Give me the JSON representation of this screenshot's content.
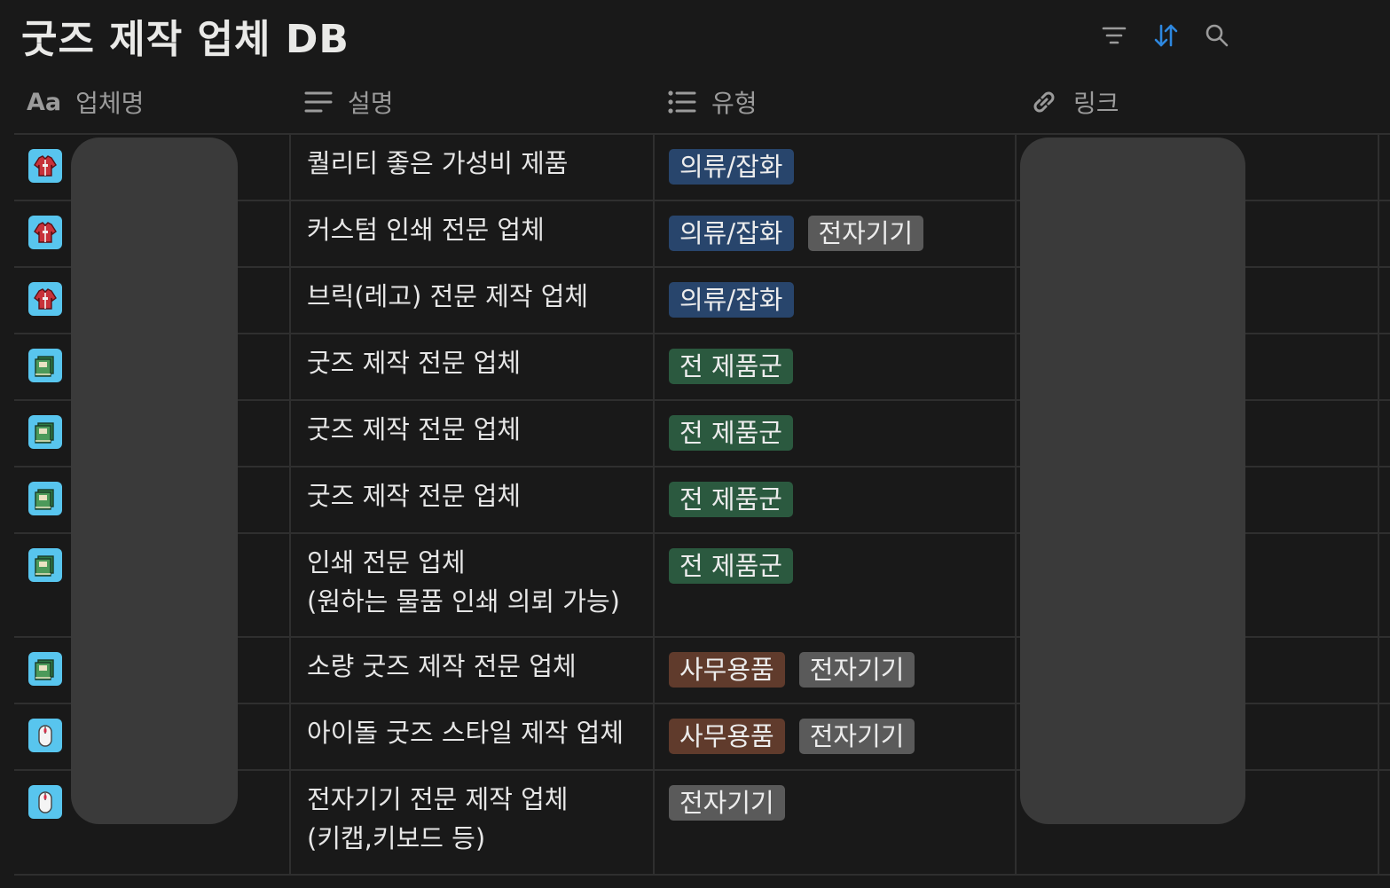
{
  "page": {
    "title": "굿즈 제작 업체 DB"
  },
  "toolbar": {
    "filter_icon": "filter-icon",
    "sort_icon": "sort-icon",
    "search_icon": "search-icon",
    "sort_active_color": "#2e88e0"
  },
  "columns": {
    "name": {
      "label": "업체명",
      "icon": "title-property-icon",
      "icon_text": "Aa"
    },
    "description": {
      "label": "설명",
      "icon": "text-property-icon"
    },
    "type": {
      "label": "유형",
      "icon": "multi-select-icon"
    },
    "link": {
      "label": "링크",
      "icon": "link-icon"
    }
  },
  "tag_colors": {
    "blue": "#28456c",
    "gray": "#5a5a5a",
    "green": "#2b593f",
    "brown": "#603b2c"
  },
  "rows": [
    {
      "icon": "jacket-icon",
      "description": "퀄리티 좋은 가성비 제품",
      "tags": [
        {
          "label": "의류/잡화",
          "color": "blue"
        }
      ]
    },
    {
      "icon": "jacket-icon",
      "description": "커스텀 인쇄 전문 업체",
      "tags": [
        {
          "label": "의류/잡화",
          "color": "blue"
        },
        {
          "label": "전자기기",
          "color": "gray"
        }
      ]
    },
    {
      "icon": "jacket-icon",
      "description": "브릭(레고) 전문 제작 업체",
      "tags": [
        {
          "label": "의류/잡화",
          "color": "blue"
        }
      ]
    },
    {
      "icon": "books-icon",
      "description": "굿즈 제작 전문 업체",
      "tags": [
        {
          "label": "전 제품군",
          "color": "green"
        }
      ]
    },
    {
      "icon": "books-icon",
      "description": "굿즈 제작 전문 업체",
      "tags": [
        {
          "label": "전 제품군",
          "color": "green"
        }
      ]
    },
    {
      "icon": "books-icon",
      "description": "굿즈 제작 전문 업체",
      "tags": [
        {
          "label": "전 제품군",
          "color": "green"
        }
      ]
    },
    {
      "icon": "books-icon",
      "description": "인쇄 전문 업체\n(원하는 물품 인쇄 의뢰 가능)",
      "tags": [
        {
          "label": "전 제품군",
          "color": "green"
        }
      ]
    },
    {
      "icon": "books-icon",
      "description": "소량 굿즈 제작 전문 업체",
      "tags": [
        {
          "label": "사무용품",
          "color": "brown"
        },
        {
          "label": "전자기기",
          "color": "gray"
        }
      ]
    },
    {
      "icon": "mouse-icon",
      "description": "아이돌 굿즈 스타일 제작 업체",
      "tags": [
        {
          "label": "사무용품",
          "color": "brown"
        },
        {
          "label": "전자기기",
          "color": "gray"
        }
      ]
    },
    {
      "icon": "mouse-icon",
      "description": "전자기기 전문 제작 업체\n(키캡,키보드 등)",
      "tags": [
        {
          "label": "전자기기",
          "color": "gray"
        }
      ]
    }
  ]
}
